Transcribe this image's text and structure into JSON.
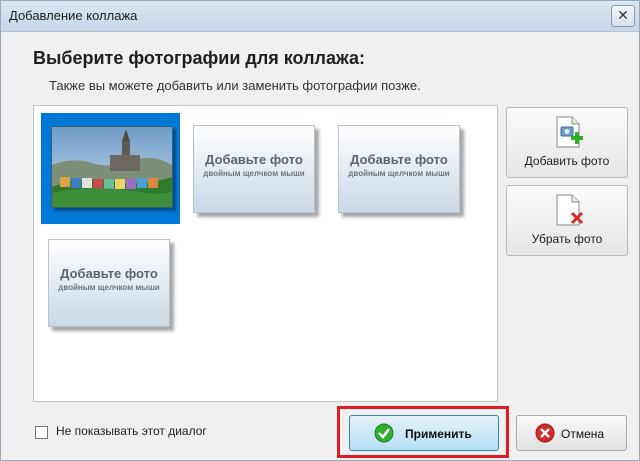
{
  "window": {
    "title": "Добавление коллажа",
    "close_glyph": "✕"
  },
  "heading": "Выберите фотографии для коллажа:",
  "subheading": "Также вы можете добавить или заменить фотографии позже.",
  "placeholder": {
    "title": "Добавьте фото",
    "subtitle": "двойным щелчком мыши"
  },
  "side_buttons": {
    "add_label": "Добавить фото",
    "remove_label": "Убрать фото"
  },
  "checkbox": {
    "label": "Не показывать этот диалог",
    "checked": false
  },
  "footer": {
    "apply_label": "Применить",
    "cancel_label": "Отмена"
  },
  "colors": {
    "selection": "#0078d7",
    "highlight": "#e01b24",
    "apply_icon": "#2fae2f",
    "cancel_icon": "#d42a2a"
  },
  "icons": {
    "close": "close-icon",
    "add_photo": "add-photo-icon",
    "remove_photo": "remove-photo-icon",
    "apply": "check-icon",
    "cancel": "cancel-icon"
  }
}
